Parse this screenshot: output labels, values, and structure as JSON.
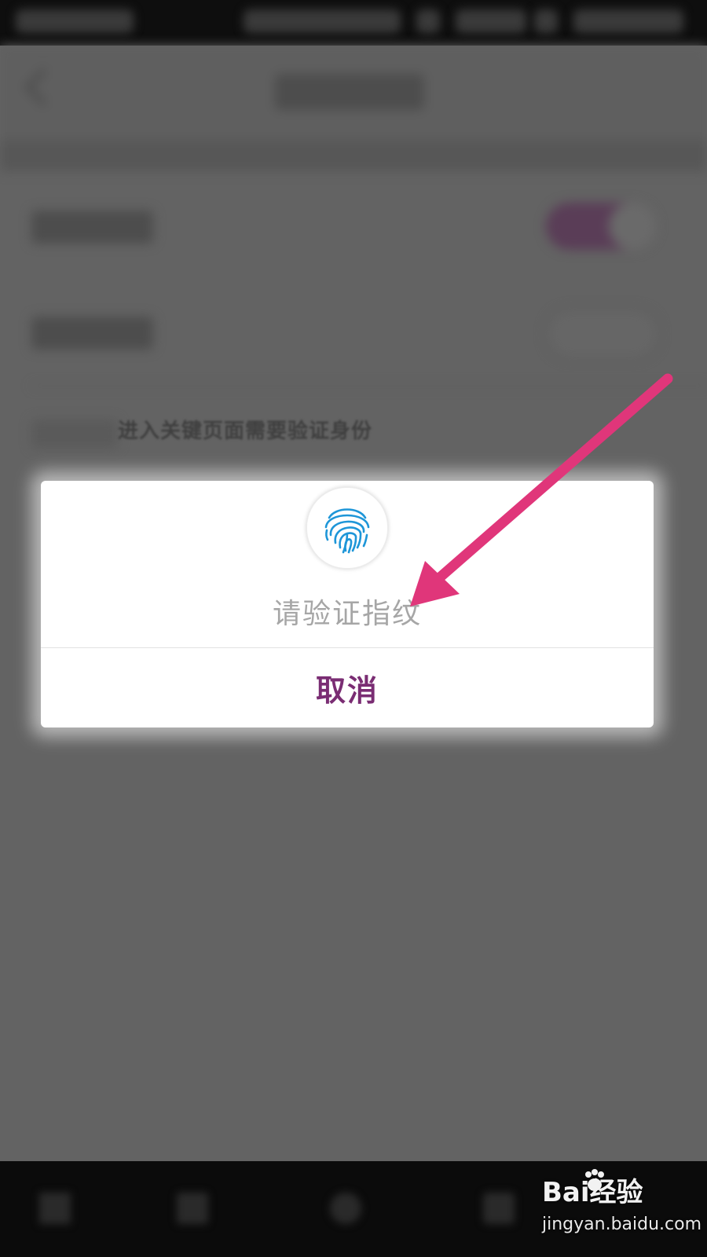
{
  "settings": {
    "hint_text": "进入关键页面需要验证身份"
  },
  "dialog": {
    "icon": "fingerprint-icon",
    "message": "请验证指纹",
    "cancel_label": "取消"
  },
  "annotation": {
    "arrow_color": "#e0367a"
  },
  "watermark": {
    "logo": "Bai经验",
    "url": "jingyan.baidu.com"
  },
  "colors": {
    "accent": "#7a2d73",
    "fingerprint": "#1e96d8",
    "overlay": "#636363"
  }
}
